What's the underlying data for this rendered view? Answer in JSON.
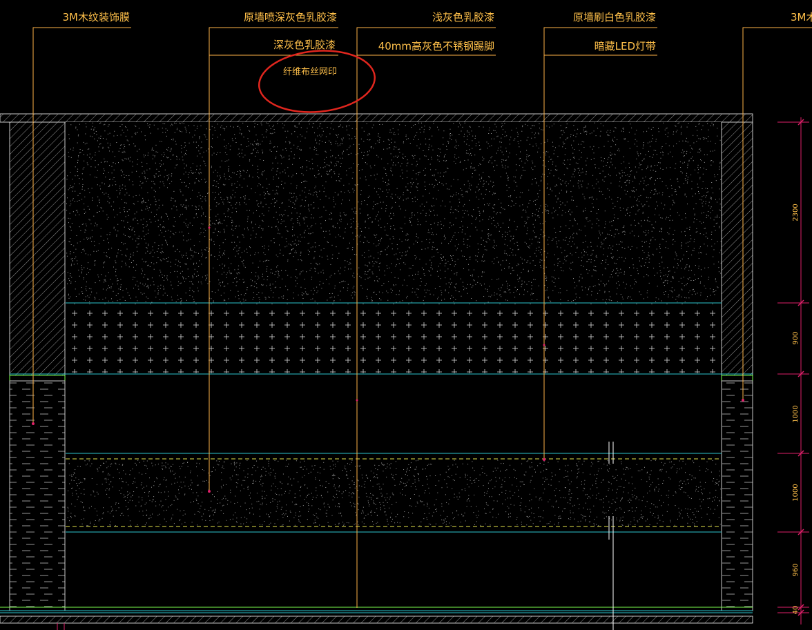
{
  "colors": {
    "background": "#000000",
    "annotation": "#ffc04a",
    "leader": "#ffb347",
    "wall": "#c8c8c8",
    "cyan": "#2bc6cf",
    "green": "#7cff4e",
    "dim": "#e0206a",
    "dash_yellow": "#e6e64a",
    "markup_circle": "#e0261e",
    "speckle": "#9a9a9a",
    "cross": "#d8d8d8"
  },
  "callouts": {
    "c1": "3M木纹装饰膜",
    "c2a": "原墙喷深灰色乳胶漆",
    "c2b": "深灰色乳胶漆",
    "c2c": "纤维布丝网印",
    "c3a": "浅灰色乳胶漆",
    "c3b": "40mm高灰色不锈钢踢脚",
    "c4a": "原墙刷白色乳胶漆",
    "c4b": "暗藏LED灯带",
    "c5": "3M木"
  },
  "dimensions": {
    "d1": "2300",
    "d2": "900",
    "d3": "1000",
    "d4": "1000",
    "d5": "960",
    "d6": "40"
  },
  "markup": {
    "shape": "red-ellipse-circle",
    "target": "c2c"
  }
}
